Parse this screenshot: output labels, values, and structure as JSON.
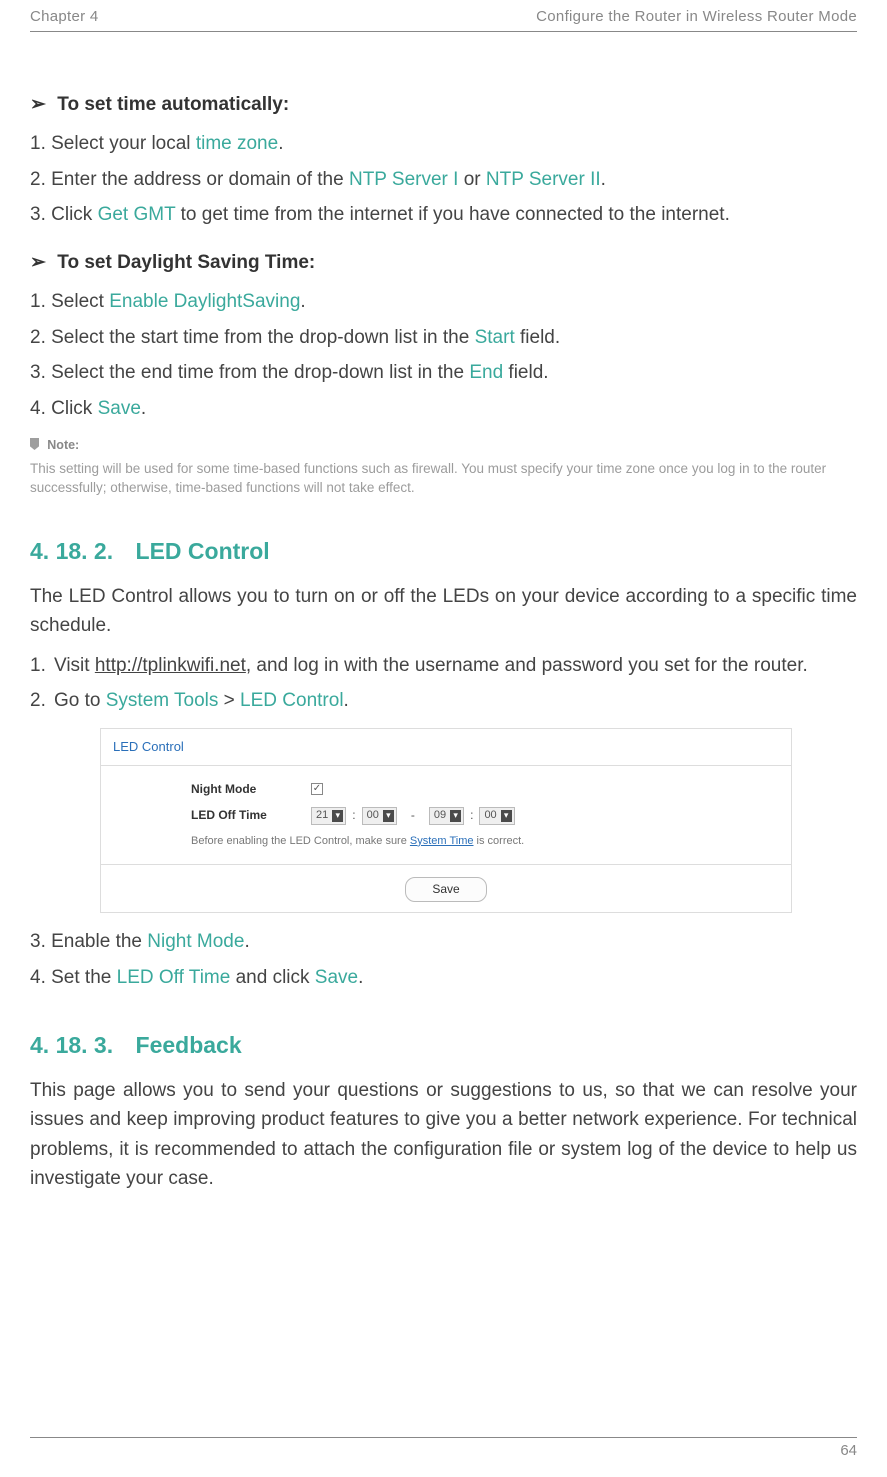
{
  "header": {
    "chapter": "Chapter 4",
    "title": "Configure the Router in Wireless Router Mode"
  },
  "auto_time": {
    "arrow": "➢",
    "heading": "To set time automatically:",
    "steps": {
      "s1_pre": "Select your local ",
      "s1_hl": "time zone",
      "s1_post": ".",
      "s2_pre": "Enter the address or domain of the ",
      "s2_hl1": "NTP Server I",
      "s2_mid": " or ",
      "s2_hl2": "NTP Server II",
      "s2_post": ".",
      "s3_pre": "Click ",
      "s3_hl": "Get GMT",
      "s3_post": " to get time from the internet if you have connected to the internet."
    }
  },
  "dst": {
    "arrow": "➢",
    "heading": "To set Daylight Saving Time:",
    "steps": {
      "s1_pre": "Select ",
      "s1_hl": "Enable DaylightSaving",
      "s1_post": ".",
      "s2_pre": "Select the start time from the drop-down list in the ",
      "s2_hl": "Start",
      "s2_post": " field.",
      "s3_pre": "Select the end time from the drop-down list in the ",
      "s3_hl": "End",
      "s3_post": " field.",
      "s4_pre": "Click ",
      "s4_hl": "Save",
      "s4_post": "."
    }
  },
  "note": {
    "label": "Note:",
    "text": "This setting will be used for some time-based functions such as firewall. You must specify your time zone once you log in to the router successfully; otherwise, time-based functions will not take effect."
  },
  "led": {
    "section_num": "4. 18. 2.",
    "section_title": "LED Control",
    "intro": "The LED Control allows you to turn on or off the LEDs on your device according to a specific time schedule.",
    "steps": {
      "s1_pre": "Visit ",
      "s1_link": "http://tplinkwifi.net",
      "s1_post": ", and log in with the username and password you set for the router.",
      "s2_pre": "Go to ",
      "s2_hl1": "System Tools",
      "s2_mid": " > ",
      "s2_hl2": "LED Control",
      "s2_post": ".",
      "s3_pre": "Enable the ",
      "s3_hl": "Night Mode",
      "s3_post": ".",
      "s4_pre": "Set the ",
      "s4_hl1": "LED Off Time",
      "s4_mid": " and click ",
      "s4_hl2": "Save",
      "s4_post": "."
    }
  },
  "led_panel": {
    "header": "LED Control",
    "night_mode_label": "Night Mode",
    "night_mode_checked": "✓",
    "off_time_label": "LED Off Time",
    "from_hour": "21",
    "from_min": "00",
    "dash": "-",
    "to_hour": "09",
    "to_min": "00",
    "colon": ":",
    "caret": "▾",
    "hint_pre": "Before enabling the LED Control, make sure ",
    "hint_link": "System Time",
    "hint_post": " is correct.",
    "save": "Save"
  },
  "feedback": {
    "section_num": "4. 18. 3.",
    "section_title": "Feedback",
    "body": "This page allows you to send your questions or suggestions to us, so that we can resolve your issues and keep improving product features to give you a better network experience. For technical problems, it is recommended to attach the configuration file or system log of the device to help us investigate your case."
  },
  "footer": {
    "page": "64"
  }
}
